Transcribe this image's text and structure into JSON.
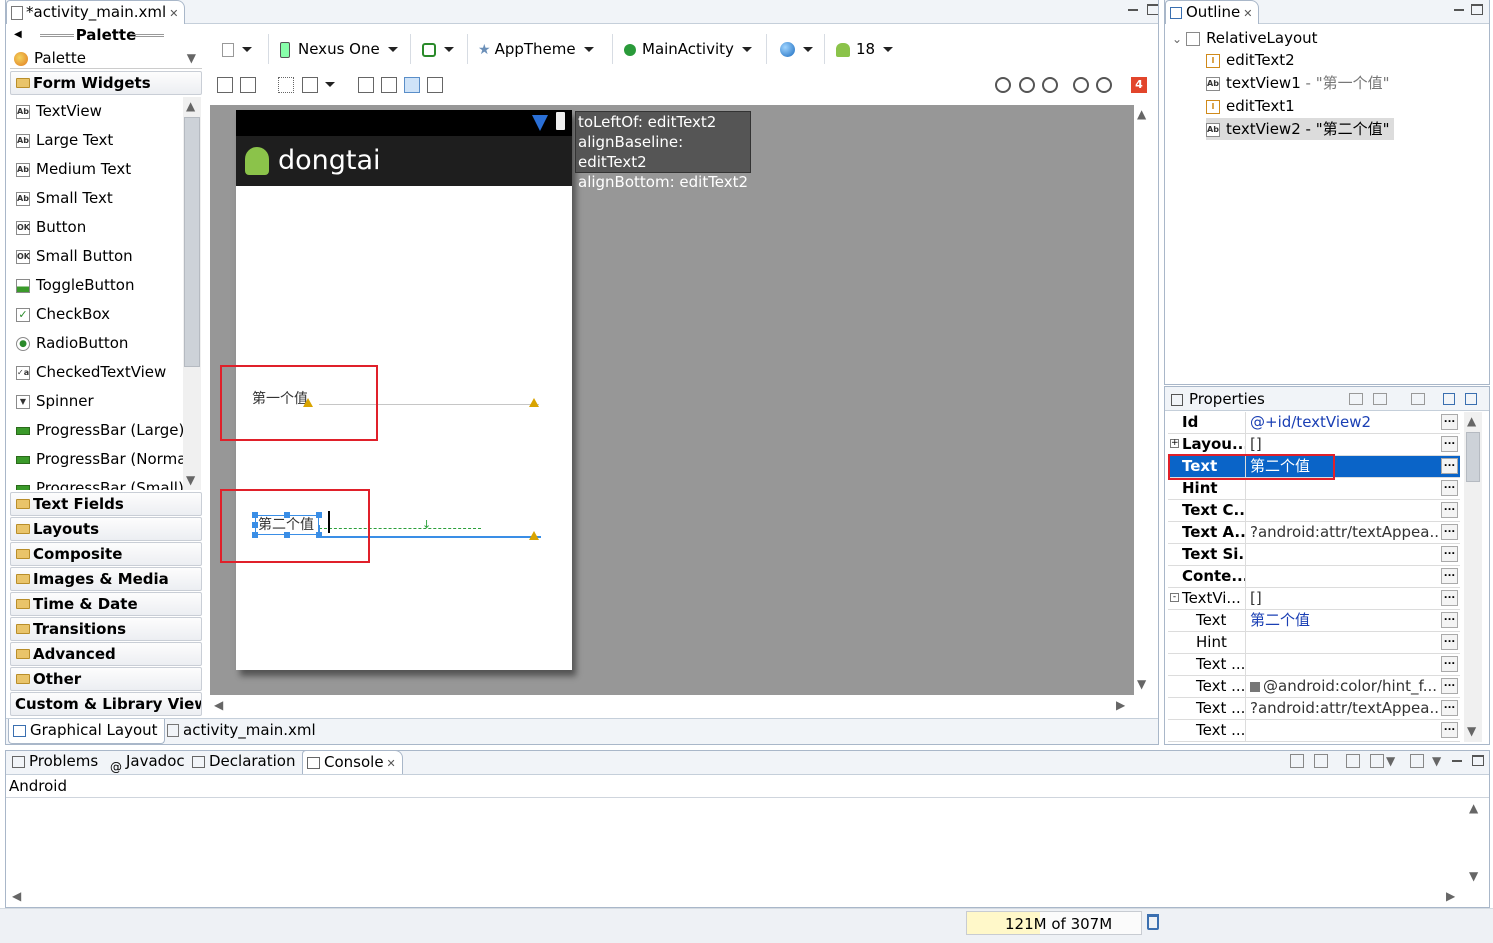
{
  "editor": {
    "tab_title": "*activity_main.xml",
    "bottom_tabs": [
      "Graphical Layout",
      "activity_main.xml"
    ]
  },
  "palette": {
    "title": "Palette",
    "dropdown_label": "Palette",
    "open_category": "Form Widgets",
    "items": [
      {
        "label": "TextView",
        "icon": "ab-icon"
      },
      {
        "label": "Large Text",
        "icon": "ab-icon"
      },
      {
        "label": "Medium Text",
        "icon": "ab-icon"
      },
      {
        "label": "Small Text",
        "icon": "ab-icon"
      },
      {
        "label": "Button",
        "icon": "ok-icon"
      },
      {
        "label": "Small Button",
        "icon": "ok-icon"
      },
      {
        "label": "ToggleButton",
        "icon": "toggle-icon"
      },
      {
        "label": "CheckBox",
        "icon": "checkbox-icon"
      },
      {
        "label": "RadioButton",
        "icon": "radio-icon"
      },
      {
        "label": "CheckedTextView",
        "icon": "checked-text-icon"
      },
      {
        "label": "Spinner",
        "icon": "spinner-icon"
      },
      {
        "label": "ProgressBar (Large)",
        "icon": "progress-icon"
      },
      {
        "label": "ProgressBar (Normal)",
        "icon": "progress-icon"
      },
      {
        "label": "ProgressBar (Small)",
        "icon": "progress-icon"
      }
    ],
    "categories": [
      "Text Fields",
      "Layouts",
      "Composite",
      "Images & Media",
      "Time & Date",
      "Transitions",
      "Advanced",
      "Other"
    ],
    "custom_label": "Custom & Library Views"
  },
  "toolbar": {
    "device": "Nexus One",
    "theme": "AppTheme",
    "activity": "MainActivity",
    "api": "18",
    "error_count": "4"
  },
  "device": {
    "app_title": "dongtai",
    "text1": "第一个值",
    "text2": "第二个值"
  },
  "tooltip": {
    "lines": [
      "toLeftOf: editText2",
      "alignBaseline: editText2",
      "alignBottom: editText2"
    ]
  },
  "outline": {
    "title": "Outline",
    "root": "RelativeLayout",
    "children": [
      {
        "label": "editText2",
        "icon": "edittext-icon"
      },
      {
        "label": "textView1",
        "suffix": " - \"第一个值\"",
        "icon": "ab-icon"
      },
      {
        "label": "editText1",
        "icon": "edittext-icon"
      },
      {
        "label": "textView2 - \"第二个值\"",
        "icon": "ab-icon",
        "selected": true
      }
    ]
  },
  "properties": {
    "title": "Properties",
    "rows": [
      {
        "name": "Id",
        "value": "@+id/textView2",
        "link": true
      },
      {
        "name": "Layou...",
        "value": "[]",
        "expand": "+"
      },
      {
        "name": "Text",
        "value": "第二个值",
        "selected": true
      },
      {
        "name": "Hint",
        "value": ""
      },
      {
        "name": "Text C...",
        "value": ""
      },
      {
        "name": "Text A...",
        "value": "?android:attr/textAppea..."
      },
      {
        "name": "Text Si...",
        "value": ""
      },
      {
        "name": "Conte...",
        "value": ""
      },
      {
        "name": "TextVi...",
        "value": "[]",
        "expand": "-",
        "plain": true
      },
      {
        "name": "Text",
        "value": "第二个值",
        "sub": true,
        "link": true
      },
      {
        "name": "Hint",
        "value": "",
        "sub": true
      },
      {
        "name": "Text ...",
        "value": "",
        "sub": true
      },
      {
        "name": "Text ...",
        "value": "@android:color/hint_f...",
        "sub": true,
        "swatch": true
      },
      {
        "name": "Text ...",
        "value": "?android:attr/textAppea...",
        "sub": true
      },
      {
        "name": "Text ...",
        "value": "",
        "sub": true
      }
    ]
  },
  "bottom": {
    "tabs": [
      "Problems",
      "Javadoc",
      "Declaration",
      "Console"
    ],
    "console_name": "Android"
  },
  "status": {
    "memory": "121M of 307M"
  },
  "colors": {
    "selection": "#0a64c8",
    "red_highlight": "#e0202a",
    "tooltip_bg": "#555555"
  }
}
